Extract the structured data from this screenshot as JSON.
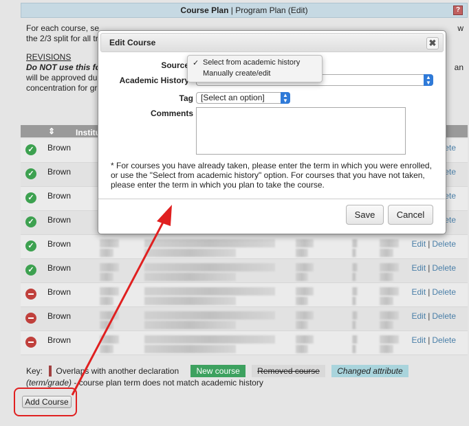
{
  "header": {
    "title_bold": "Course Plan",
    "title_rest": " | Program Plan (Edit)",
    "help_label": "?"
  },
  "intro": {
    "line1": "For each course, se",
    "line1_right": "w",
    "line2": "the 2/3 split for all tr",
    "revisions_title": "REVISIONS",
    "line3": "Do NOT use this fo",
    "line3_right": "an",
    "line4": "will be approved du",
    "line5": "concentration for gr"
  },
  "table": {
    "column_header": "Institution",
    "rows": [
      {
        "status": "ok",
        "institution": "Brown",
        "edit": "",
        "delete": "Delete"
      },
      {
        "status": "ok",
        "institution": "Brown",
        "edit": "",
        "delete": "Delete"
      },
      {
        "status": "ok",
        "institution": "Brown",
        "edit": "",
        "delete": "Delete"
      },
      {
        "status": "ok",
        "institution": "Brown",
        "edit": "",
        "delete": "Delete"
      },
      {
        "status": "ok",
        "institution": "Brown",
        "edit": "Edit",
        "delete": "Delete"
      },
      {
        "status": "ok",
        "institution": "Brown",
        "edit": "Edit",
        "delete": "Delete"
      },
      {
        "status": "bad",
        "institution": "Brown",
        "edit": "Edit",
        "delete": "Delete"
      },
      {
        "status": "bad",
        "institution": "Brown",
        "edit": "Edit",
        "delete": "Delete"
      },
      {
        "status": "bad",
        "institution": "Brown",
        "edit": "Edit",
        "delete": "Delete"
      }
    ],
    "sep": "|"
  },
  "key": {
    "label": "Key:",
    "overlap": "Overlaps with another declaration",
    "new_course": "New course",
    "removed_course": "Removed course",
    "changed_attribute": "Changed attribute",
    "note_italic": "(term/grade)",
    "note_rest": " - course plan term does not match academic history"
  },
  "add_course_label": "Add Course",
  "modal": {
    "title": "Edit Course",
    "close": "✖",
    "source_label": "Source",
    "academic_history_label": "Academic History",
    "tag_label": "Tag",
    "tag_value": "[Select an option]",
    "comments_label": "Comments",
    "note": "* For courses you have already taken, please enter the term in which you were enrolled, or use the \"Select from academic history\" option. For courses that you have not taken, please enter the term in which you plan to take the course.",
    "save": "Save",
    "cancel": "Cancel",
    "dropdown_options": [
      "Select from academic history",
      "Manually create/edit"
    ],
    "selected_option": "Select from academic history"
  },
  "colors": {
    "annotation_red": "#e02020",
    "status_ok": "#3da150",
    "status_bad": "#c0403c",
    "link": "#4a7fa8"
  }
}
